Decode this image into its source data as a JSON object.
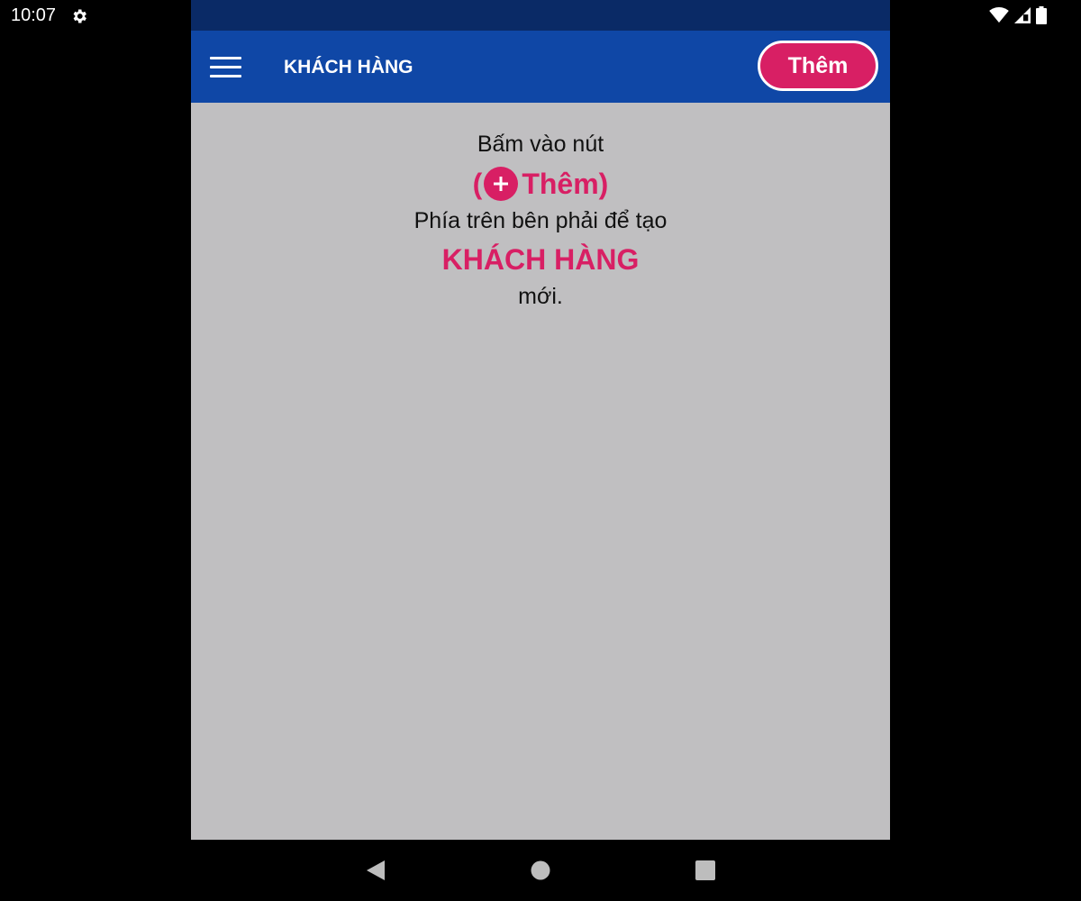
{
  "status_bar": {
    "time": "10:07",
    "icons": [
      "gear-icon",
      "wifi-icon",
      "signal-icon",
      "battery-icon"
    ]
  },
  "toolbar": {
    "menu_icon": "hamburger-icon",
    "title": "KHÁCH HÀNG",
    "add_label": "Thêm"
  },
  "empty_state": {
    "line1": "Bấm vào nút",
    "button_hint_open": "(",
    "button_hint_icon": "plus-circle-icon",
    "button_hint_label": "Thêm",
    "button_hint_close": ")",
    "line3": "Phía trên bên phải để tạo",
    "entity": "KHÁCH HÀNG",
    "line5": "mới."
  },
  "nav_bar": {
    "icons": [
      "back-icon",
      "home-icon",
      "recents-icon"
    ]
  },
  "colors": {
    "toolbar": "#0f47a6",
    "app_status_strip": "#0a2a66",
    "accent": "#d81f64",
    "content_background": "#c0bfc1"
  }
}
